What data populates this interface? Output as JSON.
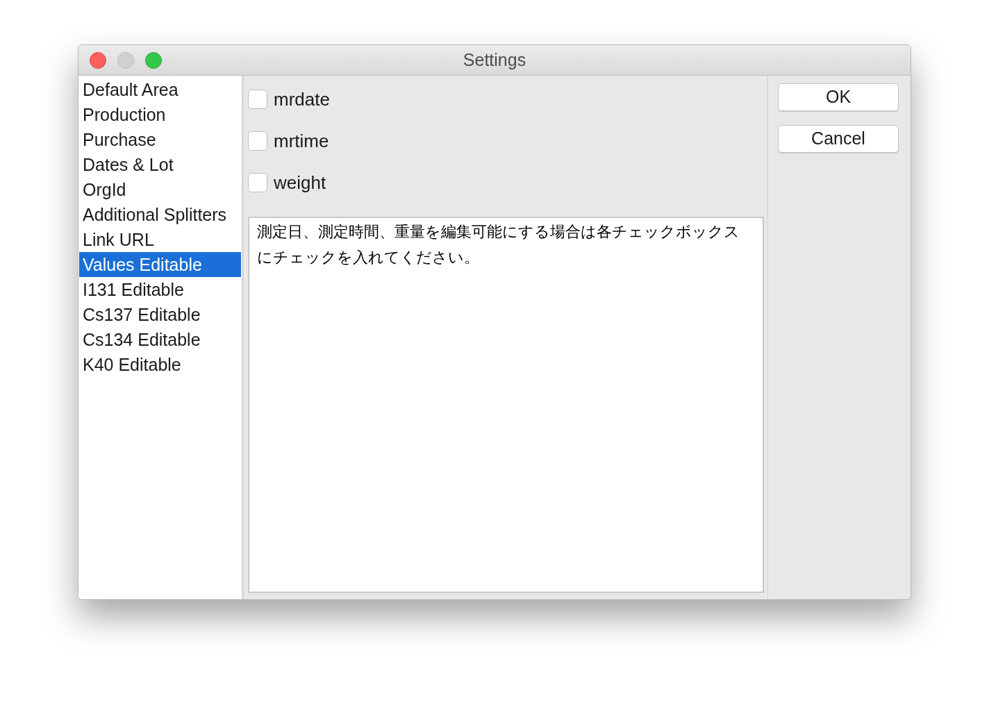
{
  "window": {
    "title": "Settings"
  },
  "sidebar": {
    "items": [
      {
        "label": "Default Area",
        "selected": false
      },
      {
        "label": "Production",
        "selected": false
      },
      {
        "label": "Purchase",
        "selected": false
      },
      {
        "label": "Dates & Lot",
        "selected": false
      },
      {
        "label": "OrgId",
        "selected": false
      },
      {
        "label": "Additional Splitters",
        "selected": false
      },
      {
        "label": "Link URL",
        "selected": false
      },
      {
        "label": "Values Editable",
        "selected": true
      },
      {
        "label": "I131 Editable",
        "selected": false
      },
      {
        "label": "Cs137 Editable",
        "selected": false
      },
      {
        "label": "Cs134 Editable",
        "selected": false
      },
      {
        "label": "K40 Editable",
        "selected": false
      }
    ]
  },
  "options": [
    {
      "label": "mrdate",
      "checked": false
    },
    {
      "label": "mrtime",
      "checked": false
    },
    {
      "label": "weight",
      "checked": false
    }
  ],
  "description": "測定日、測定時間、重量を編集可能にする場合は各チェックボックスにチェックを入れてください。",
  "buttons": [
    "OK",
    "Cancel"
  ]
}
